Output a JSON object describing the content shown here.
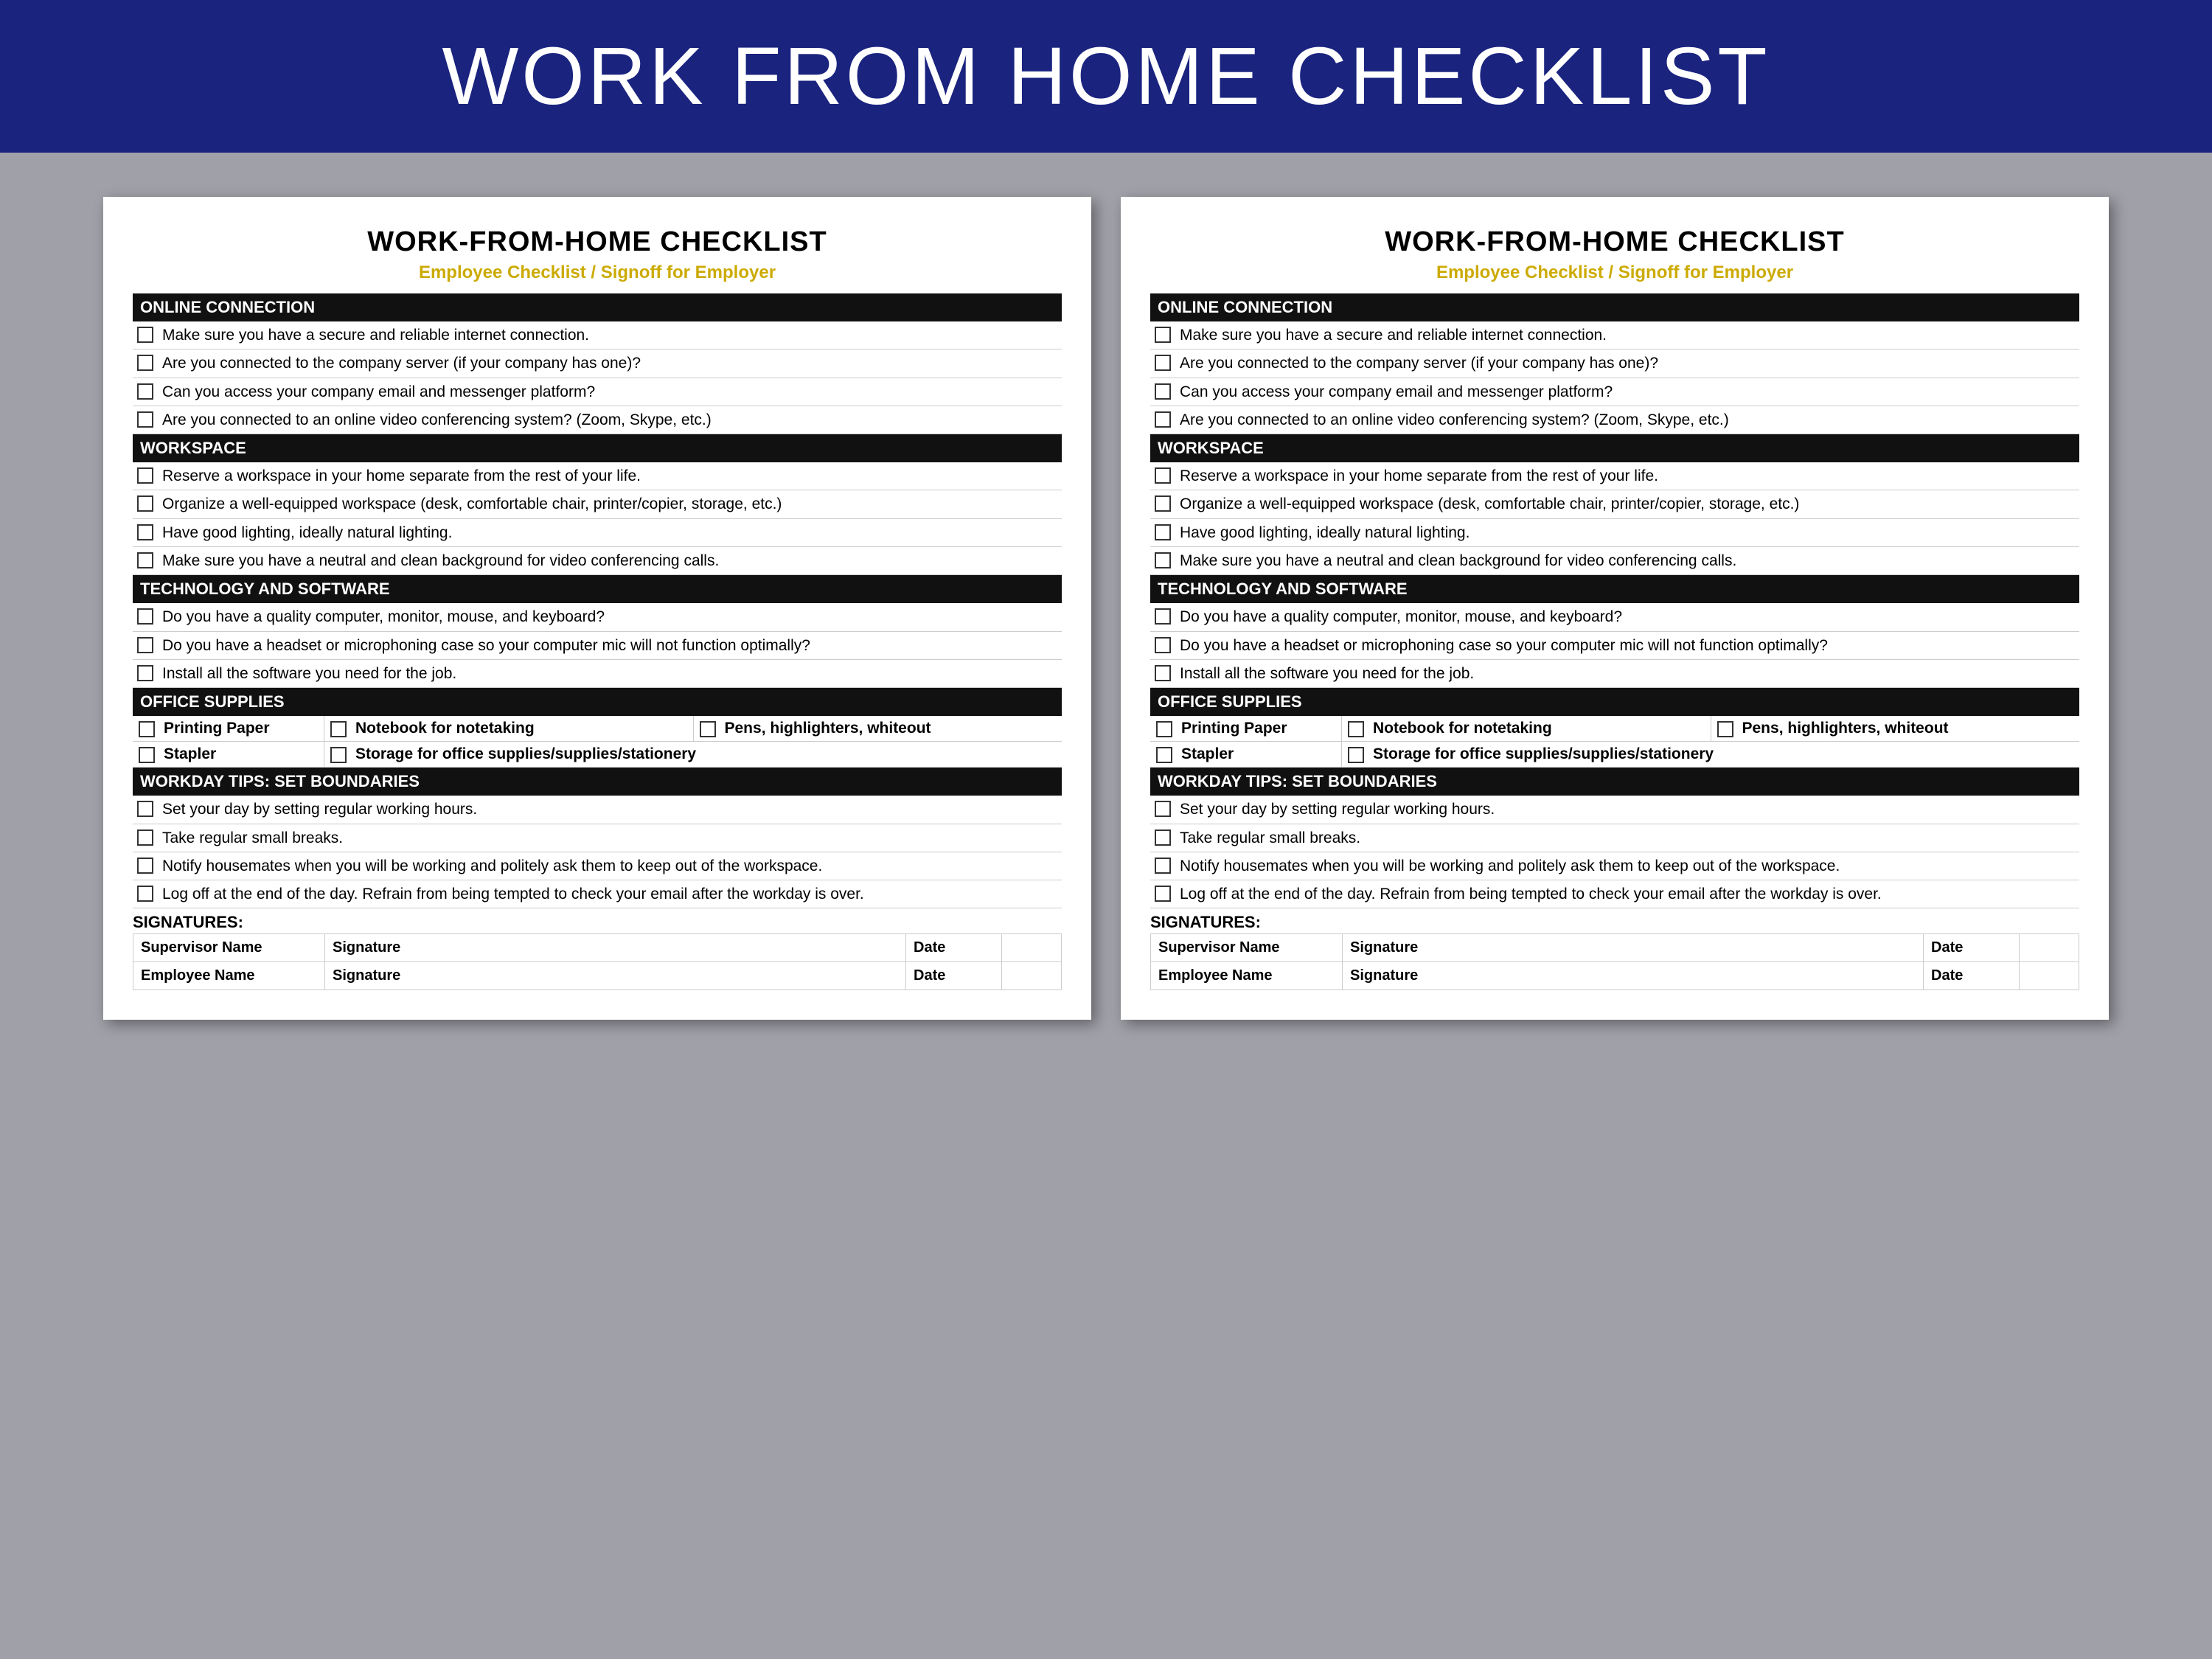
{
  "header": {
    "title": "WORK FROM HOME CHECKLIST",
    "background": "#1a237e"
  },
  "document": {
    "title": "WORK-FROM-HOME CHECKLIST",
    "subtitle": "Employee Checklist / Signoff for Employer",
    "sections": [
      {
        "id": "online-connection",
        "header": "ONLINE CONNECTION",
        "items": [
          "Make sure you have a secure and reliable internet connection.",
          "Are you connected to the company server (if your company has one)?",
          "Can you access your company email and messenger platform?",
          "Are you connected to an online video conferencing system? (Zoom, Skype, etc.)"
        ]
      },
      {
        "id": "workspace",
        "header": "WORKSPACE",
        "items": [
          "Reserve a workspace in your home separate from the rest of your life.",
          "Organize a well-equipped workspace (desk, comfortable chair, printer/copier, storage, etc.)",
          "Have good lighting, ideally natural lighting.",
          "Make sure you have a neutral and clean background for video conferencing calls."
        ]
      },
      {
        "id": "technology",
        "header": "TECHNOLOGY AND SOFTWARE",
        "items": [
          "Do you have a quality computer, monitor, mouse, and keyboard?",
          "Do you have a headset or microphoning case so your computer mic will not function optimally?",
          "Install all the software you need for the job."
        ]
      }
    ],
    "office_supplies": {
      "header": "OFFICE SUPPLIES",
      "rows": [
        [
          {
            "label": "Printing Paper"
          },
          {
            "label": "Notebook for notetaking"
          },
          {
            "label": "Pens, highlighters, whiteout"
          }
        ],
        [
          {
            "label": "Stapler"
          },
          {
            "label": "Storage for office supplies/supplies/stationery"
          }
        ]
      ]
    },
    "workday_tips": {
      "header": "WORKDAY TIPS: SET BOUNDARIES",
      "items": [
        "Set your day by setting regular working hours.",
        "Take regular small breaks.",
        "Notify housemates when you will be working and politely ask them to keep out of the workspace.",
        "Log off at the end of the day. Refrain from being tempted to check your email after the workday is over."
      ]
    },
    "signatures": {
      "header": "SIGNATURES:",
      "rows": [
        {
          "name_label": "Supervisor Name",
          "sig_label": "Signature",
          "date_label": "Date"
        },
        {
          "name_label": "Employee Name",
          "sig_label": "Signature",
          "date_label": "Date"
        }
      ]
    }
  }
}
